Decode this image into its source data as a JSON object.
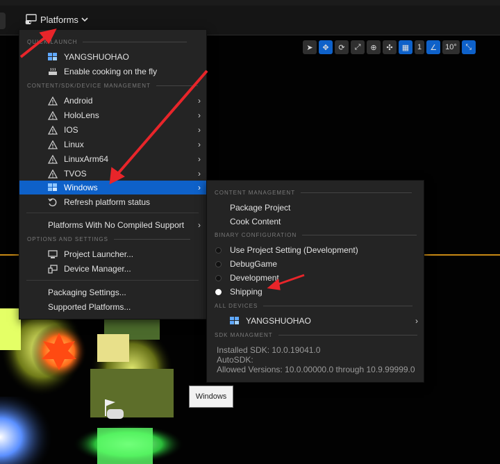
{
  "toolbar": {
    "platforms_label": "Platforms"
  },
  "viewport_toolbar": {
    "grid_value": "1",
    "angle_value": "10°"
  },
  "main_menu": {
    "quick_launch_header": "QUICK LAUNCH",
    "quick_launch": [
      {
        "label": "YANGSHUOHAO",
        "icon": "windows-pc-icon"
      },
      {
        "label": "Enable cooking on the fly",
        "icon": "cooking-pot-icon"
      }
    ],
    "device_mgmt_header": "CONTENT/SDK/DEVICE MANAGEMENT",
    "platforms": [
      {
        "label": "Android",
        "icon": "warning-icon"
      },
      {
        "label": "HoloLens",
        "icon": "warning-icon"
      },
      {
        "label": "IOS",
        "icon": "warning-icon"
      },
      {
        "label": "Linux",
        "icon": "warning-icon"
      },
      {
        "label": "LinuxArm64",
        "icon": "warning-icon"
      },
      {
        "label": "TVOS",
        "icon": "warning-icon"
      },
      {
        "label": "Windows",
        "icon": "windows-icon"
      }
    ],
    "refresh_label": "Refresh platform status",
    "no_compiled_label": "Platforms With No Compiled Support",
    "options_header": "OPTIONS AND SETTINGS",
    "project_launcher_label": "Project Launcher...",
    "device_manager_label": "Device Manager...",
    "packaging_settings_label": "Packaging Settings...",
    "supported_platforms_label": "Supported Platforms..."
  },
  "sub_menu": {
    "content_header": "CONTENT MANAGEMENT",
    "package_project_label": "Package Project",
    "cook_content_label": "Cook Content",
    "binary_header": "BINARY CONFIGURATION",
    "configs": [
      {
        "label": "Use Project Setting (Development)",
        "selected": false
      },
      {
        "label": "DebugGame",
        "selected": false
      },
      {
        "label": "Development",
        "selected": false
      },
      {
        "label": "Shipping",
        "selected": true
      }
    ],
    "devices_header": "ALL DEVICES",
    "device_label": "YANGSHUOHAO",
    "sdk_header": "SDK MANAGMENT",
    "installed_sdk": "Installed SDK: 10.0.19041.0",
    "auto_sdk": "AutoSDK:",
    "allowed_versions": "Allowed Versions: 10.0.00000.0 through 10.9.99999.0"
  },
  "tooltip": {
    "text": "Windows"
  },
  "colors": {
    "highlight": "#0e61c9",
    "menu_bg": "#242424",
    "annotation_arrow": "#e8252a"
  }
}
